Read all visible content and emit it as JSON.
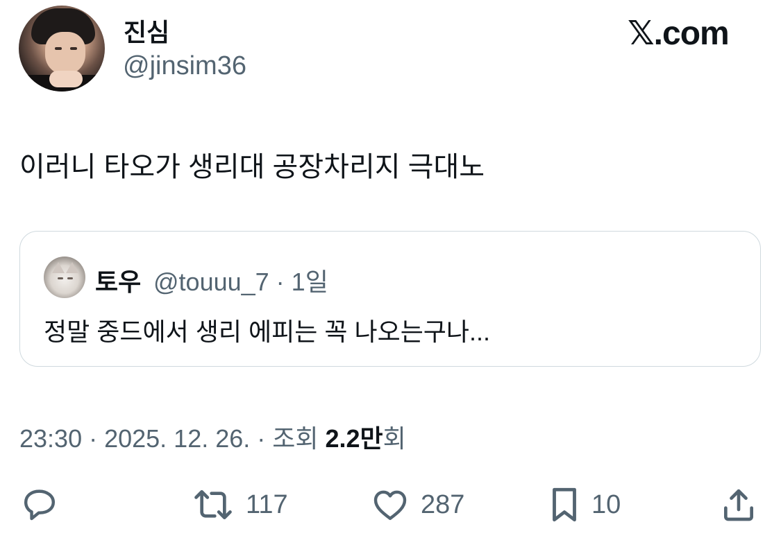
{
  "author": {
    "display_name": "진심",
    "handle": "@jinsim36"
  },
  "brand": "𝕏.com",
  "tweet": {
    "text": "이러니 타오가 생리대 공장차리지 극대노"
  },
  "quoted_tweet": {
    "display_name": "토우",
    "handle": "@touuu_7 · 1일",
    "text": "정말 중드에서 생리 에피는 꼭 나오는구나..."
  },
  "meta": {
    "timestamp": "23:30 · 2025. 12. 26. · 조회 ",
    "views": "2.2만",
    "views_suffix": "회"
  },
  "actions": {
    "reply_icon": "reply-icon",
    "retweet_count": "117",
    "like_count": "287",
    "bookmark_count": "10",
    "share_icon": "share-icon"
  },
  "colors": {
    "text": "#0f1419",
    "secondary": "#536471",
    "border": "#cfd9de"
  }
}
